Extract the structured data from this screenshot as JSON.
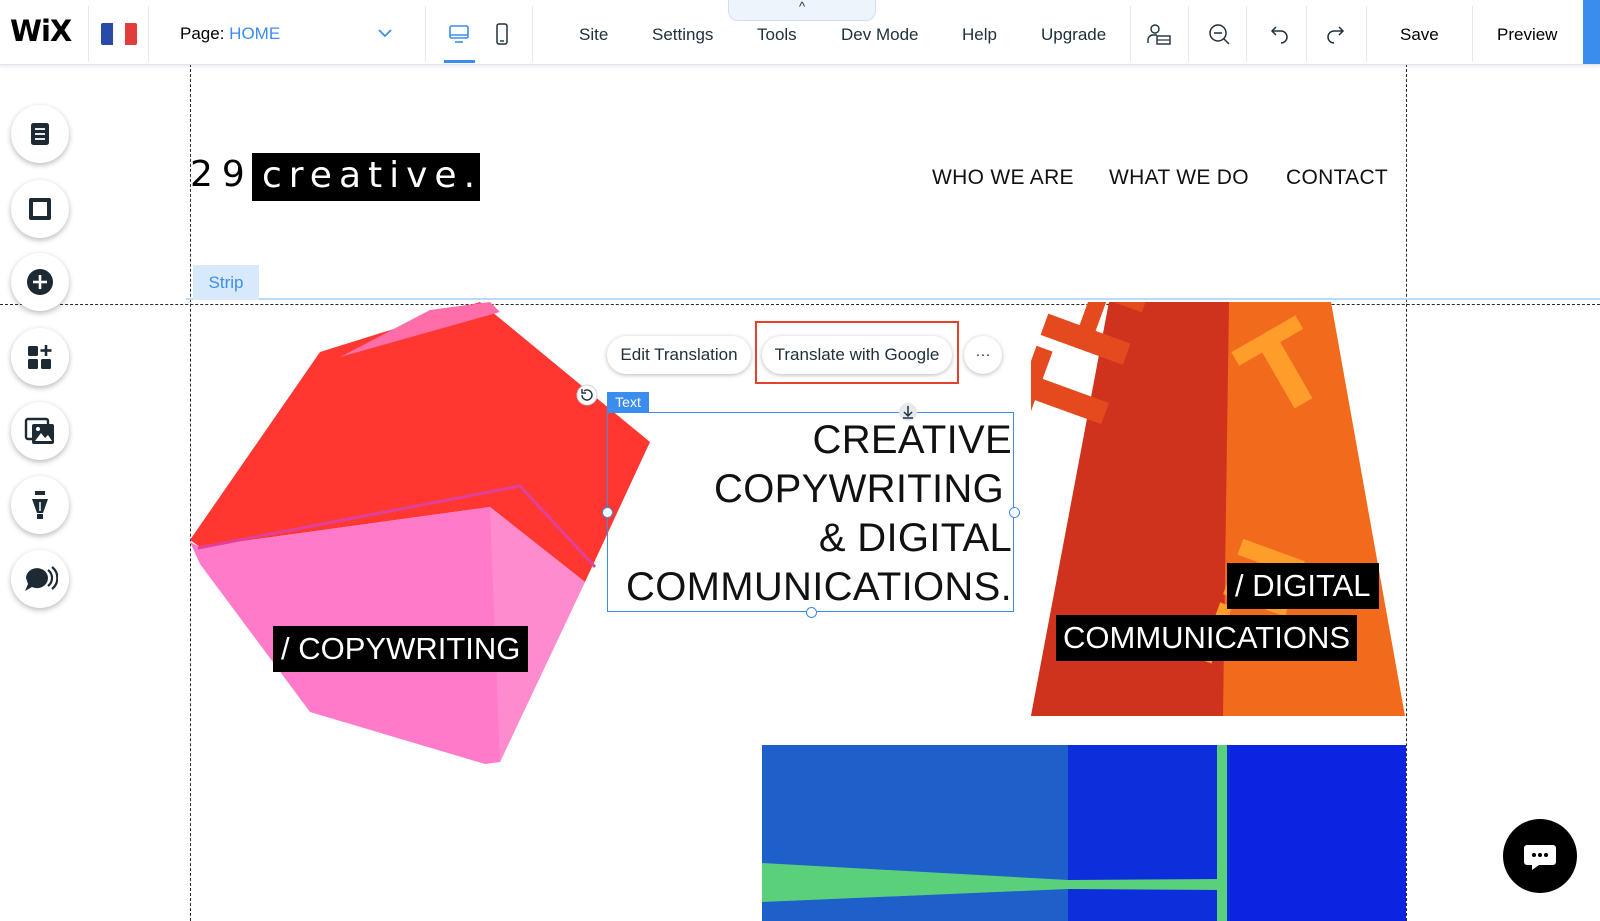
{
  "editor": {
    "logo": "WiX",
    "language_flag": "france-flag",
    "page_label": "Page:",
    "page_value": "HOME",
    "menu": [
      "Site",
      "Settings",
      "Tools",
      "Dev Mode",
      "Help",
      "Upgrade"
    ],
    "tools_tab_icon": "^",
    "save_label": "Save",
    "preview_label": "Preview",
    "accent_color": "#3b8ded"
  },
  "left_rail": [
    "pages-icon",
    "background-icon",
    "add-icon",
    "add-apps-icon",
    "media-icon",
    "blog-icon",
    "chat-icon"
  ],
  "site": {
    "brand_number": "29",
    "brand_word": "creative.",
    "nav": [
      "WHO WE ARE",
      "WHAT WE DO",
      "CONTACT"
    ],
    "strip_label": "Strip",
    "headline_lines": [
      "CREATIVE",
      "COPYWRITING",
      "& DIGITAL",
      "COMMUNICATIONS."
    ],
    "label_copywriting": "/ COPYWRITING",
    "label_digital_1": "/ DIGITAL",
    "label_digital_2": "COMMUNICATIONS"
  },
  "floating_toolbar": {
    "edit_translation": "Edit Translation",
    "translate_google": "Translate with Google",
    "more": "···",
    "selection_tag": "Text"
  }
}
